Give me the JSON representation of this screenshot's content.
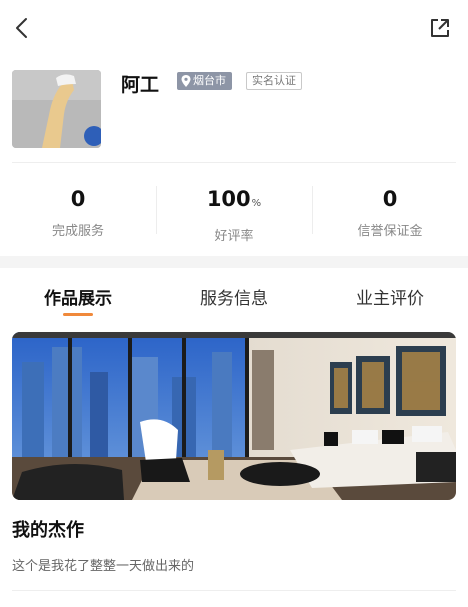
{
  "header": {
    "back_icon": "chevron-left-icon",
    "share_icon": "share-icon"
  },
  "profile": {
    "name": "阿工",
    "location": "烟台市",
    "verified_label": "实名认证",
    "location_icon": "location-pin-icon"
  },
  "stats": [
    {
      "value": "0",
      "unit": "",
      "label": "完成服务"
    },
    {
      "value": "100",
      "unit": "%",
      "label": "好评率"
    },
    {
      "value": "0",
      "unit": "",
      "label": "信誉保证金"
    }
  ],
  "tabs": [
    {
      "label": "作品展示",
      "active": true
    },
    {
      "label": "服务信息",
      "active": false
    },
    {
      "label": "业主评价",
      "active": false
    }
  ],
  "works": [
    {
      "title": "我的杰作",
      "description": "这个是我花了整整一天做出来的"
    }
  ],
  "colors": {
    "accent": "#f0893b",
    "location_badge": "#8d95a6"
  }
}
